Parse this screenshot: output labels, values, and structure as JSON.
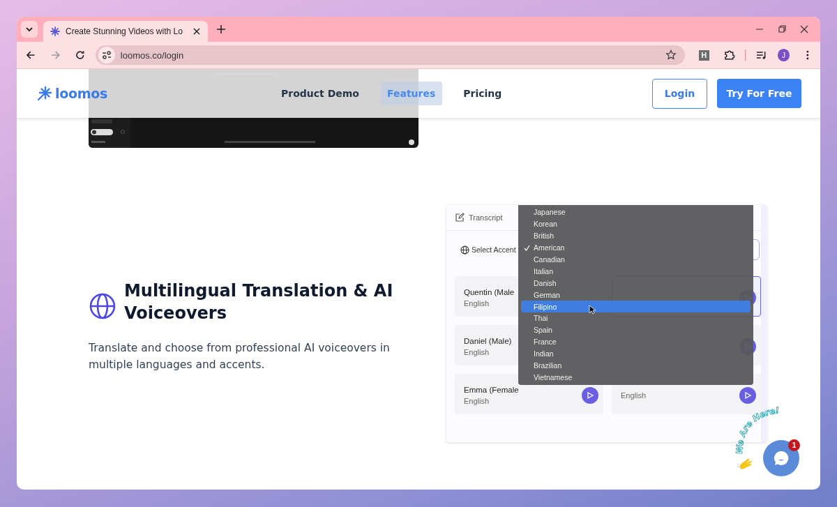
{
  "browser": {
    "tab_title": "Create Stunning Videos with Lo",
    "url": "loomos.co/login",
    "extension_label": "H",
    "profile_initial": "J"
  },
  "header": {
    "logo": "loomos",
    "nav": [
      {
        "label": "Product Demo",
        "selected": false
      },
      {
        "label": "Features",
        "selected": true
      },
      {
        "label": "Pricing",
        "selected": false
      }
    ],
    "login": "Login",
    "cta": "Try For Free"
  },
  "feature": {
    "title": "Multilingual Translation & AI Voiceovers",
    "description": "Translate and choose from professional AI voiceovers in multiple languages and accents."
  },
  "panel": {
    "tab": "Transcript",
    "accent_label": "Select Accent",
    "voices": [
      {
        "name": "Quentin (Male",
        "language": "English",
        "selected": false,
        "play": false
      },
      {
        "selected": true,
        "play": true
      },
      {
        "name": "Daniel (Male)",
        "language": "English",
        "selected": false,
        "play": false
      },
      {
        "selected": false,
        "play": true
      },
      {
        "name": "Emma (Female",
        "language": "English",
        "selected": false,
        "play": true
      },
      {
        "language": "English",
        "selected": false,
        "play": true
      }
    ]
  },
  "dropdown": {
    "options": [
      {
        "label": "Japanese",
        "checked": false,
        "selected": false
      },
      {
        "label": "Korean",
        "checked": false,
        "selected": false
      },
      {
        "label": "British",
        "checked": false,
        "selected": false
      },
      {
        "label": "American",
        "checked": true,
        "selected": false
      },
      {
        "label": "Canadian",
        "checked": false,
        "selected": false
      },
      {
        "label": "Italian",
        "checked": false,
        "selected": false
      },
      {
        "label": "Danish",
        "checked": false,
        "selected": false
      },
      {
        "label": "German",
        "checked": false,
        "selected": false
      },
      {
        "label": "Filipino",
        "checked": false,
        "selected": true
      },
      {
        "label": "Thai",
        "checked": false,
        "selected": false
      },
      {
        "label": "Spain",
        "checked": false,
        "selected": false
      },
      {
        "label": "France",
        "checked": false,
        "selected": false
      },
      {
        "label": "Indian",
        "checked": false,
        "selected": false
      },
      {
        "label": "Brazilian",
        "checked": false,
        "selected": false
      },
      {
        "label": "Vietnamese",
        "checked": false,
        "selected": false
      }
    ]
  },
  "chat": {
    "greeting": "We Are Here!",
    "badge": "1"
  }
}
